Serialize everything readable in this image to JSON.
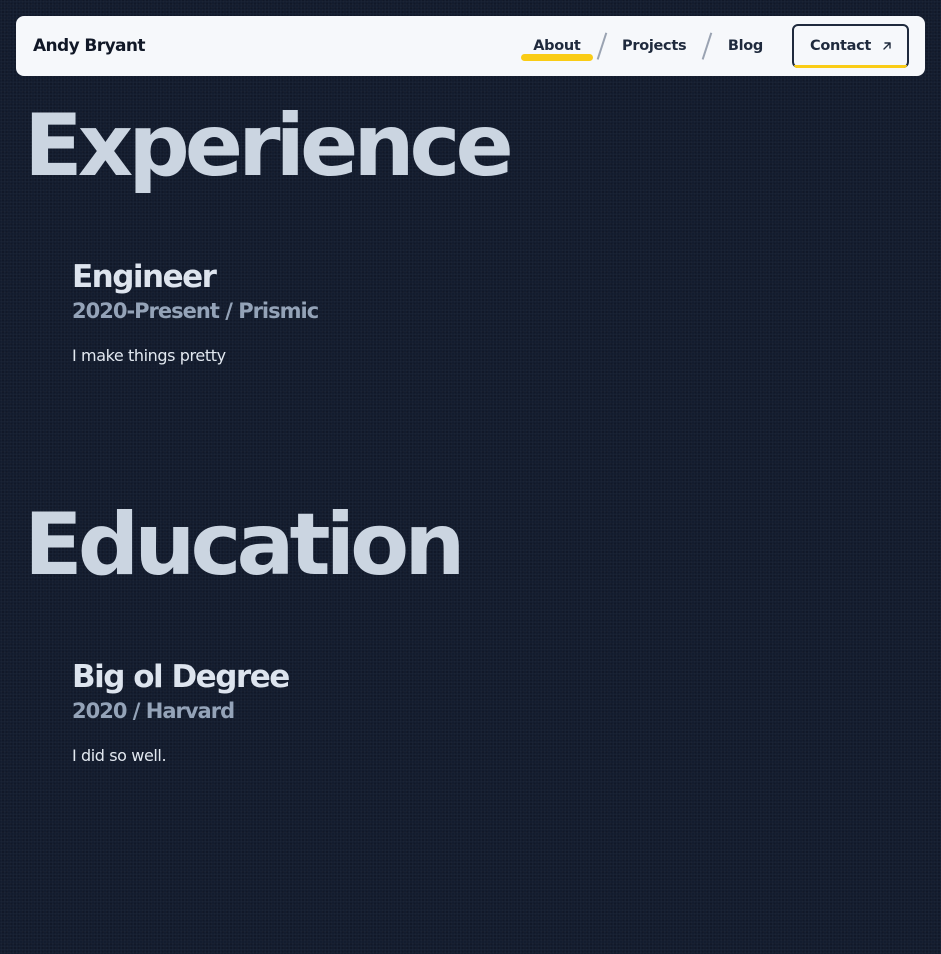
{
  "header": {
    "brand": "Andy Bryant",
    "nav": [
      {
        "label": "About",
        "active": true
      },
      {
        "label": "Projects",
        "active": false
      },
      {
        "label": "Blog",
        "active": false
      }
    ],
    "contact_label": "Contact"
  },
  "experience": {
    "heading": "Experience",
    "items": [
      {
        "title": "Engineer",
        "period": "2020-Present",
        "separator": "/",
        "organization": "Prismic",
        "description": "I make things pretty"
      }
    ]
  },
  "education": {
    "heading": "Education",
    "items": [
      {
        "title": "Big ol Degree",
        "period": "2020",
        "separator": "/",
        "organization": "Harvard",
        "description": "I did so well."
      }
    ]
  },
  "icons": {
    "contact": "arrow-up-right-icon"
  },
  "colors": {
    "background": "#131c2e",
    "navbar": "#f6f8fb",
    "accent": "#facc15",
    "heading": "#cbd5e1",
    "meta": "#94a3b8"
  }
}
